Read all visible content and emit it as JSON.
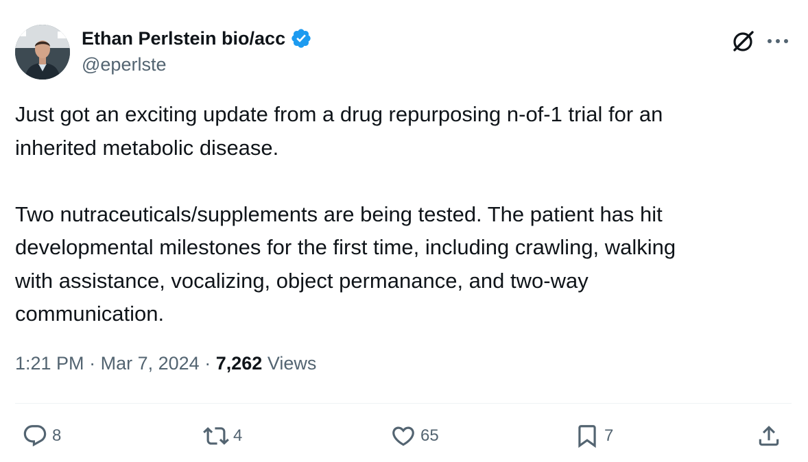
{
  "author": {
    "display_name": "Ethan Perlstein bio/acc",
    "handle": "@eperlste",
    "verified": true
  },
  "icons": {
    "verified": "verified-badge-icon",
    "grok": "grok-icon",
    "more": "more-icon",
    "reply": "reply-icon",
    "retweet": "retweet-icon",
    "like": "like-icon",
    "bookmark": "bookmark-icon",
    "share": "share-icon"
  },
  "tweet": {
    "paragraphs": [
      "Just got an exciting update from a drug repurposing n-of-1 trial for an\ninherited metabolic disease.",
      "Two nutraceuticals/supplements are being tested. The patient has hit\ndevelopmental milestones for the first time, including crawling, walking\nwith assistance, vocalizing, object permanance, and two-way\ncommunication."
    ],
    "time": "1:21 PM",
    "separator": "·",
    "date": "Mar 7, 2024",
    "views_count": "7,262",
    "views_label": "Views"
  },
  "actions": {
    "reply_count": "8",
    "retweet_count": "4",
    "like_count": "65",
    "bookmark_count": "7"
  },
  "colors": {
    "text_primary": "#0f1419",
    "text_secondary": "#536471",
    "verified_blue": "#1d9bf0",
    "divider": "#eff3f4"
  }
}
